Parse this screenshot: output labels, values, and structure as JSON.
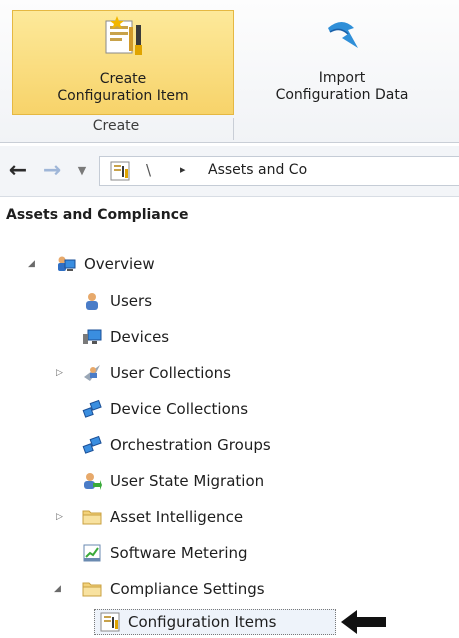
{
  "ribbon": {
    "create_item": {
      "line1": "Create",
      "line2": "Configuration Item"
    },
    "import_data": {
      "line1": "Import",
      "line2": "Configuration Data"
    },
    "group_label": "Create"
  },
  "address": {
    "separator": "\\",
    "arrow": "▸",
    "crumb": "Assets and Co"
  },
  "tree": {
    "title": "Assets and Compliance",
    "nodes": [
      {
        "label": "Overview"
      },
      {
        "label": "Users"
      },
      {
        "label": "Devices"
      },
      {
        "label": "User Collections"
      },
      {
        "label": "Device Collections"
      },
      {
        "label": "Orchestration Groups"
      },
      {
        "label": "User State Migration"
      },
      {
        "label": "Asset Intelligence"
      },
      {
        "label": "Software Metering"
      },
      {
        "label": "Compliance Settings"
      },
      {
        "label": "Configuration Items"
      }
    ]
  },
  "icons": {
    "create": "create-config-item-icon",
    "import": "import-arrow-icon",
    "back": "back-arrow-icon",
    "forward": "forward-arrow-icon",
    "pointer": "arrow-pointer-icon"
  },
  "colors": {
    "ribbon_highlight": "#f7d36a",
    "selection_border": "#7a7a7a"
  }
}
